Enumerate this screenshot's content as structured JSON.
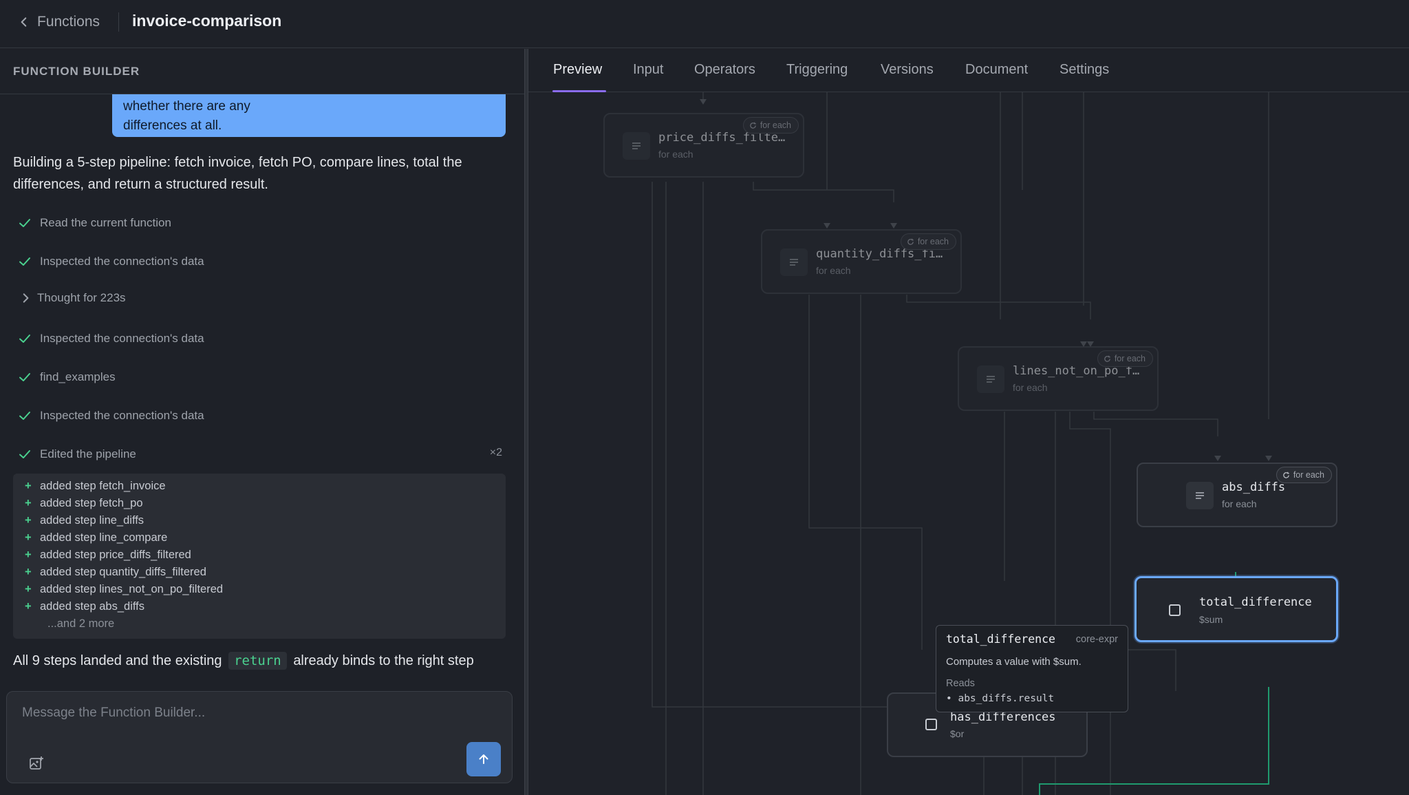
{
  "topbar": {
    "back_label": "Functions",
    "title": "invoice-comparison"
  },
  "left_panel": {
    "header": "FUNCTION BUILDER",
    "user_message_lines": [
      "whether there are any",
      "differences at all."
    ],
    "assistant_message": "Building a 5-step pipeline: fetch invoice, fetch PO, compare lines, total the differences, and return a structured result.",
    "steps": [
      {
        "label": "Read the current function",
        "icon": "check-icon"
      },
      {
        "label": "Inspected the connection's data",
        "icon": "check-icon"
      },
      {
        "label": "Thought for 223s",
        "icon": "chevron-right-icon"
      },
      {
        "label": "Inspected the connection's data",
        "icon": "check-icon"
      },
      {
        "label": "find_examples",
        "icon": "check-icon"
      },
      {
        "label": "Inspected the connection's data",
        "icon": "check-icon"
      },
      {
        "label": "Edited the pipeline",
        "icon": "check-icon",
        "count": "×2"
      }
    ],
    "changes": [
      "added step fetch_invoice",
      "added step fetch_po",
      "added step line_diffs",
      "added step line_compare",
      "added step price_diffs_filtered",
      "added step quantity_diffs_filtered",
      "added step lines_not_on_po_filtered",
      "added step abs_diffs"
    ],
    "changes_more": "...and 2 more",
    "final_message": {
      "before": "All 9 steps landed and the existing",
      "code": "return",
      "after": "already binds to the right step"
    },
    "composer": {
      "placeholder": "Message the Function Builder...",
      "value": ""
    }
  },
  "tabs": [
    "Preview",
    "Input",
    "Operators",
    "Triggering",
    "Versions",
    "Document",
    "Settings"
  ],
  "active_tab": "Preview",
  "nodes": {
    "price_diffs": {
      "name": "price_diffs_filte…",
      "sub": "for each",
      "badge": "for each"
    },
    "quantity_diffs": {
      "name": "quantity_diffs_fi…",
      "sub": "for each",
      "badge": "for each"
    },
    "lines_not_on_po": {
      "name": "lines_not_on_po_f…",
      "sub": "for each",
      "badge": "for each"
    },
    "abs_diffs": {
      "name": "abs_diffs",
      "sub": "for each",
      "badge": "for each"
    },
    "total_difference": {
      "name": "total_difference",
      "sub": "$sum"
    },
    "has_differences": {
      "name": "has_differences",
      "sub": "$or"
    }
  },
  "tooltip": {
    "name": "total_difference",
    "kind": "core-expr",
    "description": "Computes a value with $sum.",
    "reads_label": "Reads",
    "reads": [
      "• abs_diffs.result"
    ]
  },
  "colors": {
    "accent_blue": "#6aa8fa",
    "tab_underline": "#8b6cf0",
    "success_green": "#4ad18f",
    "active_edge": "#1f9a6e"
  }
}
